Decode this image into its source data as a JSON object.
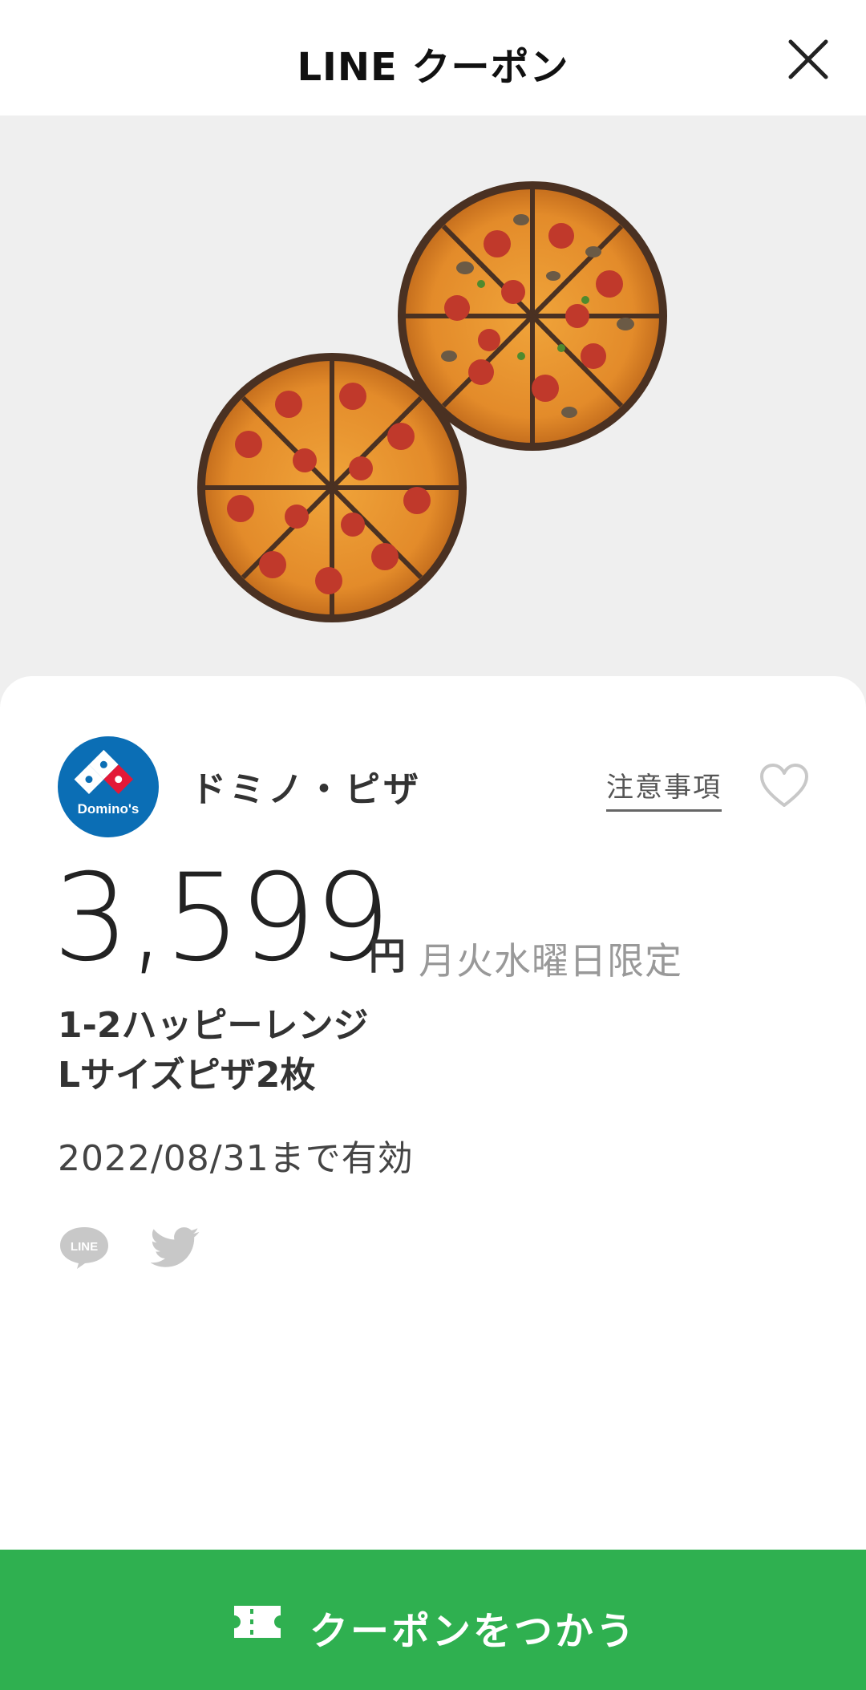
{
  "header": {
    "title": "LINE クーポン",
    "close_icon": "close-icon"
  },
  "hero": {
    "image": "two-pizzas-image"
  },
  "store": {
    "logo_text": "Domino's",
    "name": "ドミノ・ピザ",
    "notes_link": "注意事項",
    "favorite_icon": "heart-icon"
  },
  "coupon": {
    "price": "3,599",
    "currency": "円",
    "days": "月火水曜日限定",
    "description_line1": "1-2ハッピーレンジ",
    "description_line2": "Lサイズピザ2枚",
    "valid_until": "2022/08/31まで有効"
  },
  "share": {
    "line_icon": "line-share-icon",
    "line_text": "LINE",
    "twitter_icon": "twitter-share-icon"
  },
  "action": {
    "use_label": "クーポンをつかう",
    "icon": "ticket-icon"
  },
  "colors": {
    "accent": "#2fb050",
    "logo_blue": "#0b6eb5",
    "hero_bg": "#efefef"
  }
}
